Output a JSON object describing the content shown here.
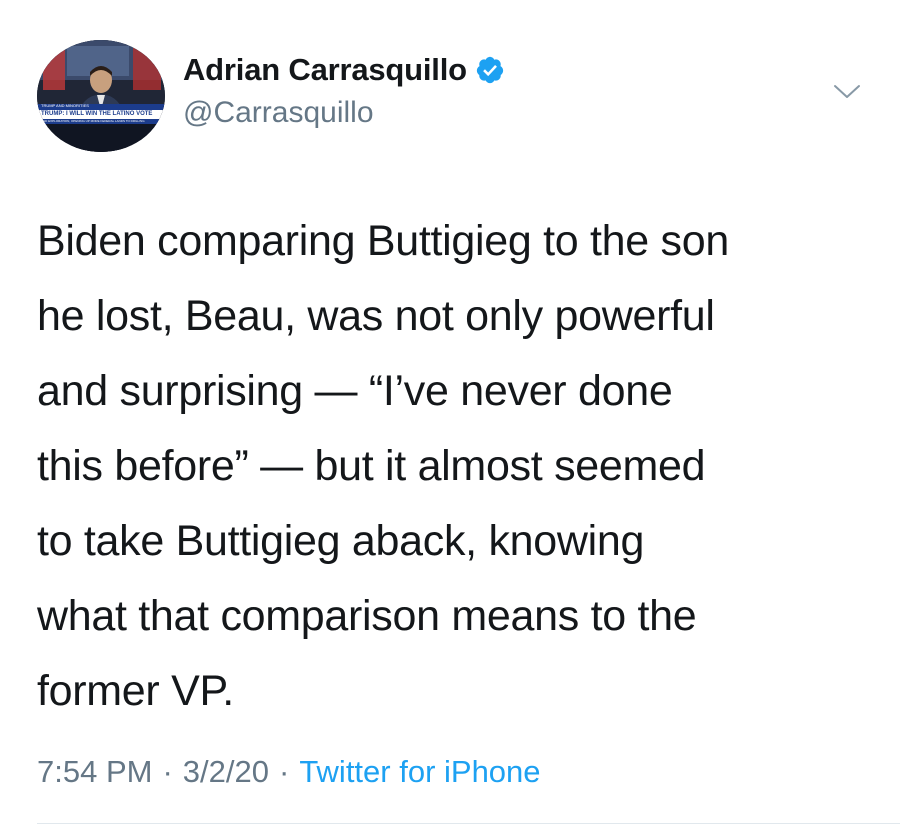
{
  "tweet": {
    "author": {
      "display_name": "Adrian Carrasquillo",
      "handle": "@Carrasquillo",
      "verified": true,
      "avatar_chyron_top": "TRUMP AND MINORITIES",
      "avatar_chyron_main": "TRUMP: I WILL WIN THE LATINO VOTE",
      "avatar_chyron_sub": "AND EXPLORATION, OPENING UP MORE FEDERAL LANDS TO DRILLING"
    },
    "text": "Biden comparing Buttigieg to the son\nhe lost, Beau, was not only powerful\nand surprising — “I’ve never done\nthis before” — but it almost seemed\nto take Buttigieg aback, knowing\nwhat that comparison means to the\nformer VP.",
    "time": "7:54 PM",
    "date": "3/2/20",
    "separator": "·",
    "source": "Twitter for iPhone"
  },
  "icons": {
    "verified": "verified-badge-icon",
    "more": "chevron-down-icon"
  },
  "colors": {
    "text": "#14171a",
    "secondary": "#657786",
    "accent": "#1da1f2",
    "divider": "#e1e8ed"
  }
}
